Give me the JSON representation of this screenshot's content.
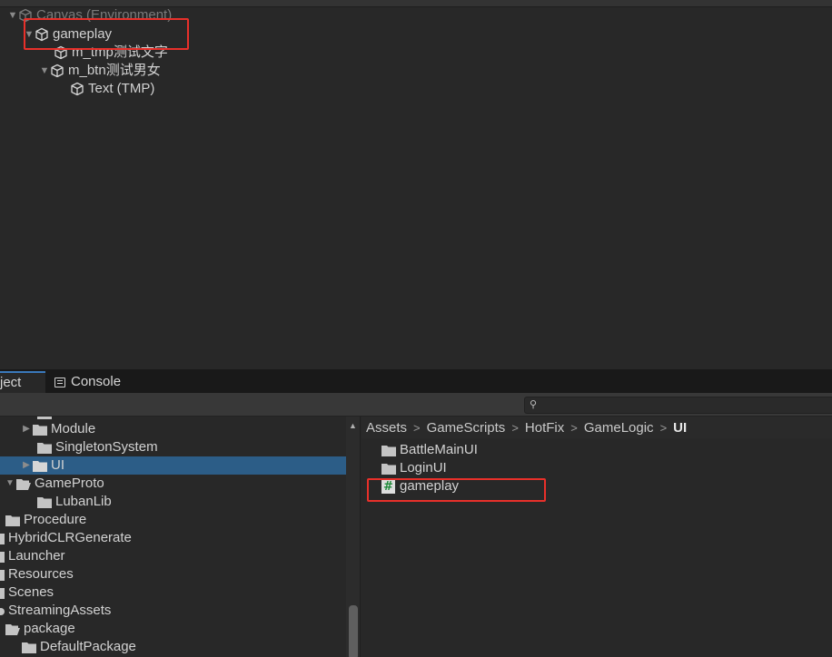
{
  "hierarchy": {
    "canvas_label": "Canvas (Environment)",
    "gameplay_label": "gameplay",
    "tmp_label": "m_tmp测试文字",
    "btn_label": "m_btn测试男女",
    "text_label": "Text (TMP)"
  },
  "project": {
    "tabs": {
      "project_label": "ject",
      "console_label": "Console"
    },
    "search": {
      "placeholder": ""
    },
    "tree": [
      {
        "label": "Module"
      },
      {
        "label": "SingletonSystem"
      },
      {
        "label": "UI"
      },
      {
        "label": "GameProto"
      },
      {
        "label": "LubanLib"
      },
      {
        "label": "Procedure"
      },
      {
        "label": "HybridCLRGenerate"
      },
      {
        "label": "Launcher"
      },
      {
        "label": "Resources"
      },
      {
        "label": "Scenes"
      },
      {
        "label": "StreamingAssets"
      },
      {
        "label": "package"
      },
      {
        "label": "DefaultPackage"
      }
    ],
    "breadcrumb": [
      "Assets",
      "GameScripts",
      "HotFix",
      "GameLogic",
      "UI"
    ],
    "files": [
      {
        "label": "BattleMainUI",
        "icon": "folder-icon"
      },
      {
        "label": "LoginUI",
        "icon": "folder-icon"
      },
      {
        "label": "gameplay",
        "icon": "csharp-script-icon"
      }
    ]
  },
  "colors": {
    "highlight": "#e8302a",
    "selection": "#2c5d87",
    "tab_accent": "#3a79bb",
    "script_icon": "#1f8a3a"
  }
}
